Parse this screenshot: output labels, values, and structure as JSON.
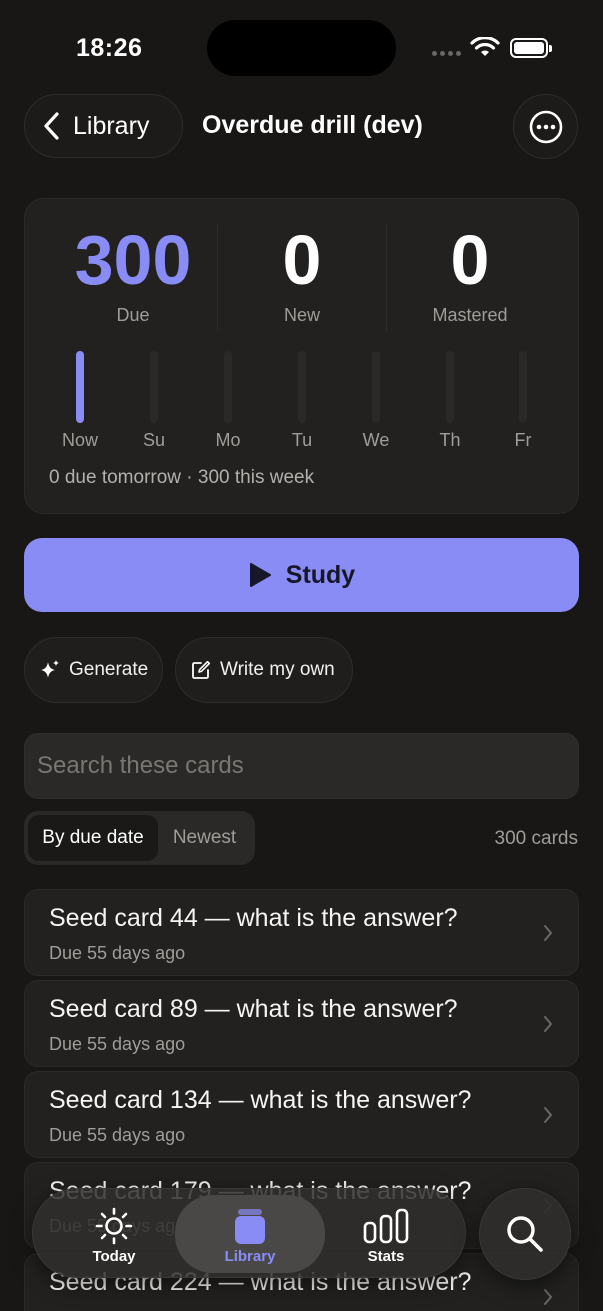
{
  "status_bar": {
    "time": "18:26"
  },
  "header": {
    "back_label": "Library",
    "title": "Overdue drill (dev)"
  },
  "stats": {
    "due_value": "300",
    "due_label": "Due",
    "new_value": "0",
    "new_label": "New",
    "mastered_value": "0",
    "mastered_label": "Mastered",
    "accent_color": "#8a8cf5"
  },
  "week": {
    "days": [
      {
        "label": "Now",
        "level": 1.0
      },
      {
        "label": "Su",
        "level": 0
      },
      {
        "label": "Mo",
        "level": 0
      },
      {
        "label": "Tu",
        "level": 0
      },
      {
        "label": "We",
        "level": 0
      },
      {
        "label": "Th",
        "level": 0
      },
      {
        "label": "Fr",
        "level": 0
      }
    ],
    "summary": "0 due tomorrow · 300 this week"
  },
  "actions": {
    "study_label": "Study",
    "generate_label": "Generate",
    "write_label": "Write my own"
  },
  "search": {
    "placeholder": "Search these cards",
    "value": ""
  },
  "sort": {
    "options": [
      "By due date",
      "Newest"
    ],
    "selected": "By due date"
  },
  "card_count": "300 cards",
  "cards": [
    {
      "question": "Seed card 44 — what is the answer?",
      "due": "Due 55 days ago"
    },
    {
      "question": "Seed card 89 — what is the answer?",
      "due": "Due 55 days ago"
    },
    {
      "question": "Seed card 134 — what is the answer?",
      "due": "Due 55 days ago"
    },
    {
      "question": "Seed card 179 — what is the answer?",
      "due": "Due 55 days ago"
    },
    {
      "question": "Seed card 224 — what is the answer?",
      "due": ""
    }
  ],
  "nav": {
    "items": [
      {
        "label": "Today",
        "icon": "sun-icon"
      },
      {
        "label": "Library",
        "icon": "library-icon"
      },
      {
        "label": "Stats",
        "icon": "bar-chart-icon"
      }
    ],
    "active": "Library",
    "search_icon": "search-icon"
  }
}
